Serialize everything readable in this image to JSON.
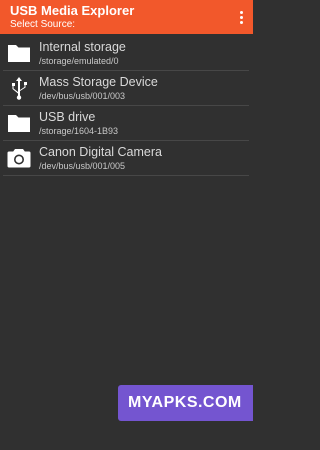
{
  "colors": {
    "toolbar": "#f2582b",
    "background": "#303030",
    "watermark": "#7455d0"
  },
  "toolbar": {
    "title": "USB Media Explorer",
    "subtitle": "Select Source:",
    "menu_icon": "more-vert-icon"
  },
  "sources": [
    {
      "name": "Internal storage",
      "path": "/storage/emulated/0",
      "icon": "folder-icon"
    },
    {
      "name": "Mass Storage Device",
      "path": "/dev/bus/usb/001/003",
      "icon": "usb-icon"
    },
    {
      "name": "USB drive",
      "path": "/storage/1604-1B93",
      "icon": "folder-icon"
    },
    {
      "name": "Canon Digital Camera",
      "path": "/dev/bus/usb/001/005",
      "icon": "camera-icon"
    }
  ],
  "watermark": {
    "text": "MYAPKS.COM"
  }
}
